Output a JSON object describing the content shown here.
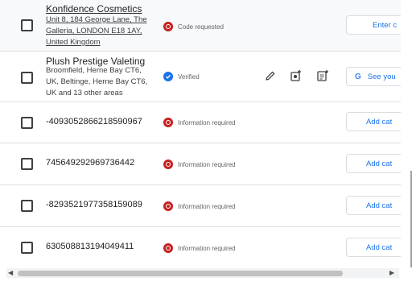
{
  "rows": [
    {
      "name": "Konfidence Cosmetics",
      "address": "Unit 8, 184 George Lane, The Galleria, LONDON E18 1AY, United Kingdom",
      "status": "Code requested",
      "action": "Enter c"
    },
    {
      "name": "Plush Prestige Valeting",
      "address": "Broomfield, Herne Bay CT6, UK, Beltinge, Herne Bay CT6, UK and 13 other areas",
      "status": "Verified",
      "action": "See you"
    },
    {
      "name": "-4093052866218590967",
      "status": "Information required",
      "action": "Add cat"
    },
    {
      "name": "745649292969736442",
      "status": "Information required",
      "action": "Add cat"
    },
    {
      "name": "-8293521977358159089",
      "status": "Information required",
      "action": "Add cat"
    },
    {
      "name": "630508813194049411",
      "status": "Information required",
      "action": "Add cat"
    }
  ],
  "icons": {
    "error": "error-circle-icon",
    "verified": "verified-badge-icon",
    "edit": "pencil-icon",
    "photo": "add-photo-icon",
    "post": "add-post-icon",
    "google": "google-g-icon"
  },
  "colors": {
    "accent": "#1a73e8",
    "error": "#c5221f",
    "text": "#202124",
    "muted": "#5f6368",
    "border": "#e0e0e0"
  }
}
